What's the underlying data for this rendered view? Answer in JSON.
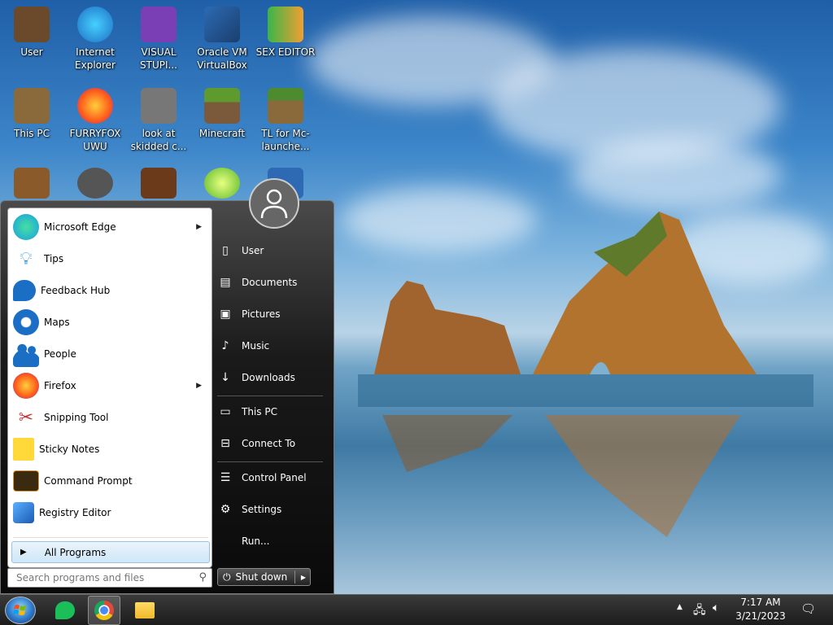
{
  "desktop": {
    "icons": [
      {
        "label": "User",
        "color": "#6b4a2b"
      },
      {
        "label": "Internet Explorer",
        "color": "#1e8ad6"
      },
      {
        "label": "VISUAL STUPI...",
        "color": "#7a3fb5"
      },
      {
        "label": "Oracle VM VirtualBox",
        "color": "#1c4f8f"
      },
      {
        "label": "SEX EDITOR",
        "color": "#e0e0e0"
      },
      {
        "label": "This PC",
        "color": "#8a6a3a"
      },
      {
        "label": "FURRYFOX UWU",
        "color": "#ff7a1a"
      },
      {
        "label": "look at skidded c...",
        "color": "#777777"
      },
      {
        "label": "Minecraft",
        "color": "#4e7a2e"
      },
      {
        "label": "TL for Mc-launche...",
        "color": "#5b8a30"
      }
    ]
  },
  "start_menu": {
    "programs": [
      {
        "label": "Microsoft Edge",
        "has_submenu": true,
        "icon": "edge-icon",
        "color": "#1b9de2"
      },
      {
        "label": "Tips",
        "has_submenu": false,
        "icon": "lightbulb-icon",
        "color": "#1a8ad4"
      },
      {
        "label": "Feedback Hub",
        "has_submenu": false,
        "icon": "feedback-icon",
        "color": "#1a6fc4"
      },
      {
        "label": "Maps",
        "has_submenu": false,
        "icon": "map-pin-icon",
        "color": "#1a6fc4"
      },
      {
        "label": "People",
        "has_submenu": false,
        "icon": "people-icon",
        "color": "#1a6fc4"
      },
      {
        "label": "Firefox",
        "has_submenu": true,
        "icon": "firefox-icon",
        "color": "#ff7a1a"
      },
      {
        "label": "Snipping Tool",
        "has_submenu": false,
        "icon": "scissors-icon",
        "color": "#d9d9d9"
      },
      {
        "label": "Sticky Notes",
        "has_submenu": false,
        "icon": "sticky-note-icon",
        "color": "#ffd83a"
      },
      {
        "label": "Command Prompt",
        "has_submenu": false,
        "icon": "terminal-icon",
        "color": "#3a2a10"
      },
      {
        "label": "Registry Editor",
        "has_submenu": false,
        "icon": "registry-icon",
        "color": "#2a7ad4"
      }
    ],
    "all_programs_label": "All Programs",
    "search_placeholder": "Search programs and files",
    "right_items": [
      {
        "label": "User",
        "icon": "user-folder-icon",
        "glyph": "🗋"
      },
      {
        "label": "Documents",
        "icon": "document-icon",
        "glyph": "🗎"
      },
      {
        "label": "Pictures",
        "icon": "picture-icon",
        "glyph": "▣"
      },
      {
        "label": "Music",
        "icon": "music-note-icon",
        "glyph": "♪"
      },
      {
        "label": "Downloads",
        "icon": "download-icon",
        "glyph": "↓"
      },
      {
        "label": "This PC",
        "icon": "monitor-icon",
        "glyph": "▭"
      },
      {
        "label": "Connect To",
        "icon": "connect-icon",
        "glyph": "⊟"
      },
      {
        "label": "Control Panel",
        "icon": "control-panel-icon",
        "glyph": "☰"
      },
      {
        "label": "Settings",
        "icon": "gear-icon",
        "glyph": "⚙"
      },
      {
        "label": "Run...",
        "icon": "run-icon",
        "glyph": ""
      }
    ],
    "shutdown_label": "Shut down"
  },
  "taskbar": {
    "time": "7:17 AM",
    "date": "3/21/2023",
    "apps": [
      {
        "name": "messages-app",
        "color": "#1bbf5a"
      },
      {
        "name": "chrome",
        "color": "#e04a3a"
      },
      {
        "name": "file-explorer",
        "color": "#f0b92a"
      }
    ]
  }
}
